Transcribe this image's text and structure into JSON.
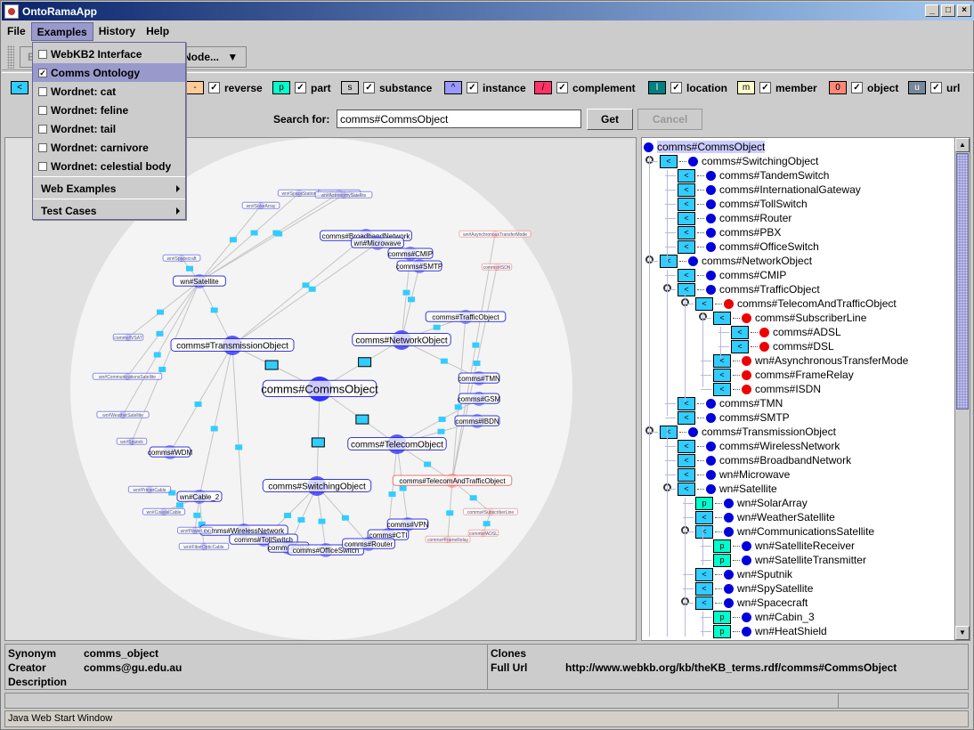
{
  "window": {
    "title": "OntoRamaApp"
  },
  "menubar": {
    "items": [
      "File",
      "Examples",
      "History",
      "Help"
    ],
    "active": "Examples"
  },
  "toolbar": {
    "back_label": "Back",
    "node_label": "Node..."
  },
  "examples_menu": {
    "items": [
      {
        "label": "WebKB2 Interface",
        "checked": false
      },
      {
        "label": "Comms Ontology",
        "checked": true
      },
      {
        "label": "Wordnet: cat",
        "checked": false
      },
      {
        "label": "Wordnet: feline",
        "checked": false
      },
      {
        "label": "Wordnet: tail",
        "checked": false
      },
      {
        "label": "Wordnet: carnivore",
        "checked": false
      },
      {
        "label": "Wordnet: celestial body",
        "checked": false
      }
    ],
    "submenus": [
      "Web Examples",
      "Test Cases"
    ]
  },
  "legend": [
    {
      "symbol": "<",
      "label": "",
      "color": "#33ccff",
      "checked": true
    },
    {
      "symbol": "-",
      "label": "reverse",
      "color": "#ffcc99",
      "checked": true
    },
    {
      "symbol": "p",
      "label": "part",
      "color": "#00ffcc",
      "checked": true
    },
    {
      "symbol": "s",
      "label": "substance",
      "color": "#cccccc",
      "checked": true
    },
    {
      "symbol": "^",
      "label": "instance",
      "color": "#9999ff",
      "checked": true
    },
    {
      "symbol": "/",
      "label": "complement",
      "color": "#ff3366",
      "checked": true
    },
    {
      "symbol": "l",
      "label": "location",
      "color": "#008080",
      "checked": true
    },
    {
      "symbol": "m",
      "label": "member",
      "color": "#ffffcc",
      "checked": true
    },
    {
      "symbol": "0",
      "label": "object",
      "color": "#ff8877",
      "checked": true
    },
    {
      "symbol": "u",
      "label": "url",
      "color": "#778899",
      "checked": true
    }
  ],
  "search": {
    "label": "Search for:",
    "value": "comms#CommsObject",
    "get_label": "Get",
    "cancel_label": "Cancel"
  },
  "graph": {
    "nodes": [
      {
        "id": "root",
        "label": "comms#CommsObject",
        "kind": "blue",
        "size": "large"
      },
      {
        "id": "trans",
        "label": "comms#TransmissionObject",
        "kind": "blue",
        "size": "medium"
      },
      {
        "id": "net",
        "label": "comms#NetworkObject",
        "kind": "blue",
        "size": "medium"
      },
      {
        "id": "tele",
        "label": "comms#TelecomObject",
        "kind": "blue",
        "size": "medium"
      },
      {
        "id": "switch",
        "label": "comms#SwitchingObject",
        "kind": "blue",
        "size": "medium"
      },
      {
        "id": "sat",
        "label": "wn#Satellite",
        "kind": "blue",
        "size": "small"
      },
      {
        "id": "wdm",
        "label": "comms#WDM",
        "kind": "blue",
        "size": "small"
      },
      {
        "id": "cable",
        "label": "wn#Cable_2",
        "kind": "blue",
        "size": "small"
      },
      {
        "id": "broad",
        "label": "comms#BroadbandNetwork",
        "kind": "blue",
        "size": "small"
      },
      {
        "id": "micro",
        "label": "wn#Microwave",
        "kind": "blue",
        "size": "small"
      },
      {
        "id": "cmip",
        "label": "comms#CMIP",
        "kind": "blue",
        "size": "small"
      },
      {
        "id": "smtp",
        "label": "comms#SMTP",
        "kind": "blue",
        "size": "small"
      },
      {
        "id": "traffic",
        "label": "comms#TrafficObject",
        "kind": "blue",
        "size": "small"
      },
      {
        "id": "tmn",
        "label": "comms#TMN",
        "kind": "blue",
        "size": "small"
      },
      {
        "id": "gsm",
        "label": "comms#GSM",
        "kind": "blue",
        "size": "small"
      },
      {
        "id": "isdn2",
        "label": "comms#IBDN",
        "kind": "blue",
        "size": "small"
      },
      {
        "id": "tat",
        "label": "comms#TelecomAndTrafficObject",
        "kind": "red",
        "size": "small"
      },
      {
        "id": "vpn",
        "label": "comms#VPN",
        "kind": "blue",
        "size": "small"
      },
      {
        "id": "cti",
        "label": "comms#CTI",
        "kind": "blue",
        "size": "small"
      },
      {
        "id": "wireless",
        "label": "comms#WirelessNetwork",
        "kind": "blue",
        "size": "small"
      },
      {
        "id": "toll",
        "label": "comms#TollSwitch",
        "kind": "blue",
        "size": "small"
      },
      {
        "id": "pbx",
        "label": "comms#PBX",
        "kind": "blue",
        "size": "small"
      },
      {
        "id": "office",
        "label": "comms#OfficeSwitch",
        "kind": "blue",
        "size": "small"
      },
      {
        "id": "router",
        "label": "comms#Router",
        "kind": "blue",
        "size": "small"
      },
      {
        "id": "spacecraft",
        "label": "wn#Spacecraft",
        "kind": "blue",
        "size": "tiny"
      },
      {
        "id": "vsat",
        "label": "comms#VSAT",
        "kind": "blue",
        "size": "tiny"
      },
      {
        "id": "commsat",
        "label": "wn#CommunicationsSatellite",
        "kind": "blue",
        "size": "tiny"
      },
      {
        "id": "weather",
        "label": "wn#WeatherSatellite",
        "kind": "blue",
        "size": "tiny"
      },
      {
        "id": "sputnik",
        "label": "wn#Sputnik",
        "kind": "blue",
        "size": "tiny"
      },
      {
        "id": "solar",
        "label": "wn#SolarArray",
        "kind": "blue",
        "size": "tiny"
      },
      {
        "id": "station",
        "label": "wn#SpaceStation",
        "kind": "blue",
        "size": "tiny"
      },
      {
        "id": "spy",
        "label": "wn#SpySatellite",
        "kind": "blue",
        "size": "tiny"
      },
      {
        "id": "astro",
        "label": "wn#AstronomySatellite",
        "kind": "blue",
        "size": "tiny"
      },
      {
        "id": "printer",
        "label": "wn#PrinterCable",
        "kind": "blue",
        "size": "tiny"
      },
      {
        "id": "coax",
        "label": "wn#CoaxialCable",
        "kind": "blue",
        "size": "tiny"
      },
      {
        "id": "power",
        "label": "wn#PowerLine",
        "kind": "blue",
        "size": "tiny"
      },
      {
        "id": "fiber",
        "label": "wn#FiberOpticCable",
        "kind": "blue",
        "size": "tiny"
      },
      {
        "id": "atm",
        "label": "wn#AsynchronousTransferMode",
        "kind": "red",
        "size": "tiny"
      },
      {
        "id": "isdn",
        "label": "comms#ISDN",
        "kind": "red",
        "size": "tiny"
      },
      {
        "id": "subline",
        "label": "comms#SubscriberLine",
        "kind": "red",
        "size": "tiny"
      },
      {
        "id": "frame",
        "label": "comms#FrameRelay",
        "kind": "red",
        "size": "tiny"
      },
      {
        "id": "adsl",
        "label": "comms#ADSL",
        "kind": "red",
        "size": "tiny"
      }
    ],
    "edges": [
      [
        "root",
        "trans"
      ],
      [
        "root",
        "net"
      ],
      [
        "root",
        "tele"
      ],
      [
        "root",
        "switch"
      ],
      [
        "trans",
        "sat"
      ],
      [
        "trans",
        "wdm"
      ],
      [
        "trans",
        "cable"
      ],
      [
        "trans",
        "broad"
      ],
      [
        "trans",
        "micro"
      ],
      [
        "trans",
        "wireless"
      ],
      [
        "net",
        "cmip"
      ],
      [
        "net",
        "smtp"
      ],
      [
        "net",
        "traffic"
      ],
      [
        "net",
        "tmn"
      ],
      [
        "tele",
        "gsm"
      ],
      [
        "tele",
        "isdn2"
      ],
      [
        "tele",
        "tat"
      ],
      [
        "tele",
        "vpn"
      ],
      [
        "tele",
        "cti"
      ],
      [
        "switch",
        "toll"
      ],
      [
        "switch",
        "pbx"
      ],
      [
        "switch",
        "office"
      ],
      [
        "switch",
        "router"
      ],
      [
        "sat",
        "spacecraft"
      ],
      [
        "sat",
        "vsat"
      ],
      [
        "sat",
        "commsat"
      ],
      [
        "sat",
        "weather"
      ],
      [
        "sat",
        "sputnik"
      ],
      [
        "sat",
        "solar"
      ],
      [
        "sat",
        "station"
      ],
      [
        "sat",
        "spy"
      ],
      [
        "sat",
        "astro"
      ],
      [
        "cable",
        "printer"
      ],
      [
        "cable",
        "coax"
      ],
      [
        "cable",
        "power"
      ],
      [
        "cable",
        "fiber"
      ],
      [
        "tat",
        "atm"
      ],
      [
        "tat",
        "isdn"
      ],
      [
        "tat",
        "subline"
      ],
      [
        "tat",
        "frame"
      ],
      [
        "subline",
        "adsl"
      ],
      [
        "traffic",
        "tat"
      ]
    ]
  },
  "tree": {
    "rows": [
      {
        "depth": 0,
        "rel": "",
        "label": "comms#CommsObject",
        "color": "blue",
        "toggle": false,
        "selected": true
      },
      {
        "depth": 1,
        "rel": "<",
        "label": "comms#SwitchingObject",
        "color": "blue",
        "toggle": true
      },
      {
        "depth": 2,
        "rel": "<",
        "label": "comms#TandemSwitch",
        "color": "blue"
      },
      {
        "depth": 2,
        "rel": "<",
        "label": "comms#InternationalGateway",
        "color": "blue"
      },
      {
        "depth": 2,
        "rel": "<",
        "label": "comms#TollSwitch",
        "color": "blue"
      },
      {
        "depth": 2,
        "rel": "<",
        "label": "comms#Router",
        "color": "blue"
      },
      {
        "depth": 2,
        "rel": "<",
        "label": "comms#PBX",
        "color": "blue"
      },
      {
        "depth": 2,
        "rel": "<",
        "label": "comms#OfficeSwitch",
        "color": "blue"
      },
      {
        "depth": 1,
        "rel": "<",
        "label": "comms#NetworkObject",
        "color": "blue",
        "toggle": true
      },
      {
        "depth": 2,
        "rel": "<",
        "label": "comms#CMIP",
        "color": "blue"
      },
      {
        "depth": 2,
        "rel": "<",
        "label": "comms#TrafficObject",
        "color": "blue",
        "toggle": true
      },
      {
        "depth": 3,
        "rel": "<",
        "label": "comms#TelecomAndTrafficObject",
        "color": "red",
        "toggle": true
      },
      {
        "depth": 4,
        "rel": "<",
        "label": "comms#SubscriberLine",
        "color": "red",
        "toggle": true
      },
      {
        "depth": 5,
        "rel": "<",
        "label": "comms#ADSL",
        "color": "red"
      },
      {
        "depth": 5,
        "rel": "<",
        "label": "comms#DSL",
        "color": "red"
      },
      {
        "depth": 4,
        "rel": "<",
        "label": "wn#AsynchronousTransferMode",
        "color": "red"
      },
      {
        "depth": 4,
        "rel": "<",
        "label": "comms#FrameRelay",
        "color": "red"
      },
      {
        "depth": 4,
        "rel": "<",
        "label": "comms#ISDN",
        "color": "red"
      },
      {
        "depth": 2,
        "rel": "<",
        "label": "comms#TMN",
        "color": "blue"
      },
      {
        "depth": 2,
        "rel": "<",
        "label": "comms#SMTP",
        "color": "blue"
      },
      {
        "depth": 1,
        "rel": "<",
        "label": "comms#TransmissionObject",
        "color": "blue",
        "toggle": true
      },
      {
        "depth": 2,
        "rel": "<",
        "label": "comms#WirelessNetwork",
        "color": "blue"
      },
      {
        "depth": 2,
        "rel": "<",
        "label": "comms#BroadbandNetwork",
        "color": "blue"
      },
      {
        "depth": 2,
        "rel": "<",
        "label": "wn#Microwave",
        "color": "blue"
      },
      {
        "depth": 2,
        "rel": "<",
        "label": "wn#Satellite",
        "color": "blue",
        "toggle": true
      },
      {
        "depth": 3,
        "rel": "p",
        "label": "wn#SolarArray",
        "color": "blue"
      },
      {
        "depth": 3,
        "rel": "<",
        "label": "wn#WeatherSatellite",
        "color": "blue"
      },
      {
        "depth": 3,
        "rel": "<",
        "label": "wn#CommunicationsSatellite",
        "color": "blue",
        "toggle": true
      },
      {
        "depth": 4,
        "rel": "p",
        "label": "wn#SatelliteReceiver",
        "color": "blue"
      },
      {
        "depth": 4,
        "rel": "p",
        "label": "wn#SatelliteTransmitter",
        "color": "blue"
      },
      {
        "depth": 3,
        "rel": "<",
        "label": "wn#Sputnik",
        "color": "blue"
      },
      {
        "depth": 3,
        "rel": "<",
        "label": "wn#SpySatellite",
        "color": "blue"
      },
      {
        "depth": 3,
        "rel": "<",
        "label": "wn#Spacecraft",
        "color": "blue",
        "toggle": true
      },
      {
        "depth": 4,
        "rel": "p",
        "label": "wn#Cabin_3",
        "color": "blue"
      },
      {
        "depth": 4,
        "rel": "p",
        "label": "wn#HeatShield",
        "color": "blue"
      }
    ]
  },
  "info": {
    "synonym_label": "Synonym",
    "synonym_value": "comms_object",
    "creator_label": "Creator",
    "creator_value": "comms@gu.edu.au",
    "description_label": "Description",
    "clones_label": "Clones",
    "fullurl_label": "Full Url",
    "fullurl_value": "http://www.webkb.org/kb/theKB_terms.rdf/comms#CommsObject"
  },
  "status": {
    "jws_label": "Java Web Start Window"
  }
}
